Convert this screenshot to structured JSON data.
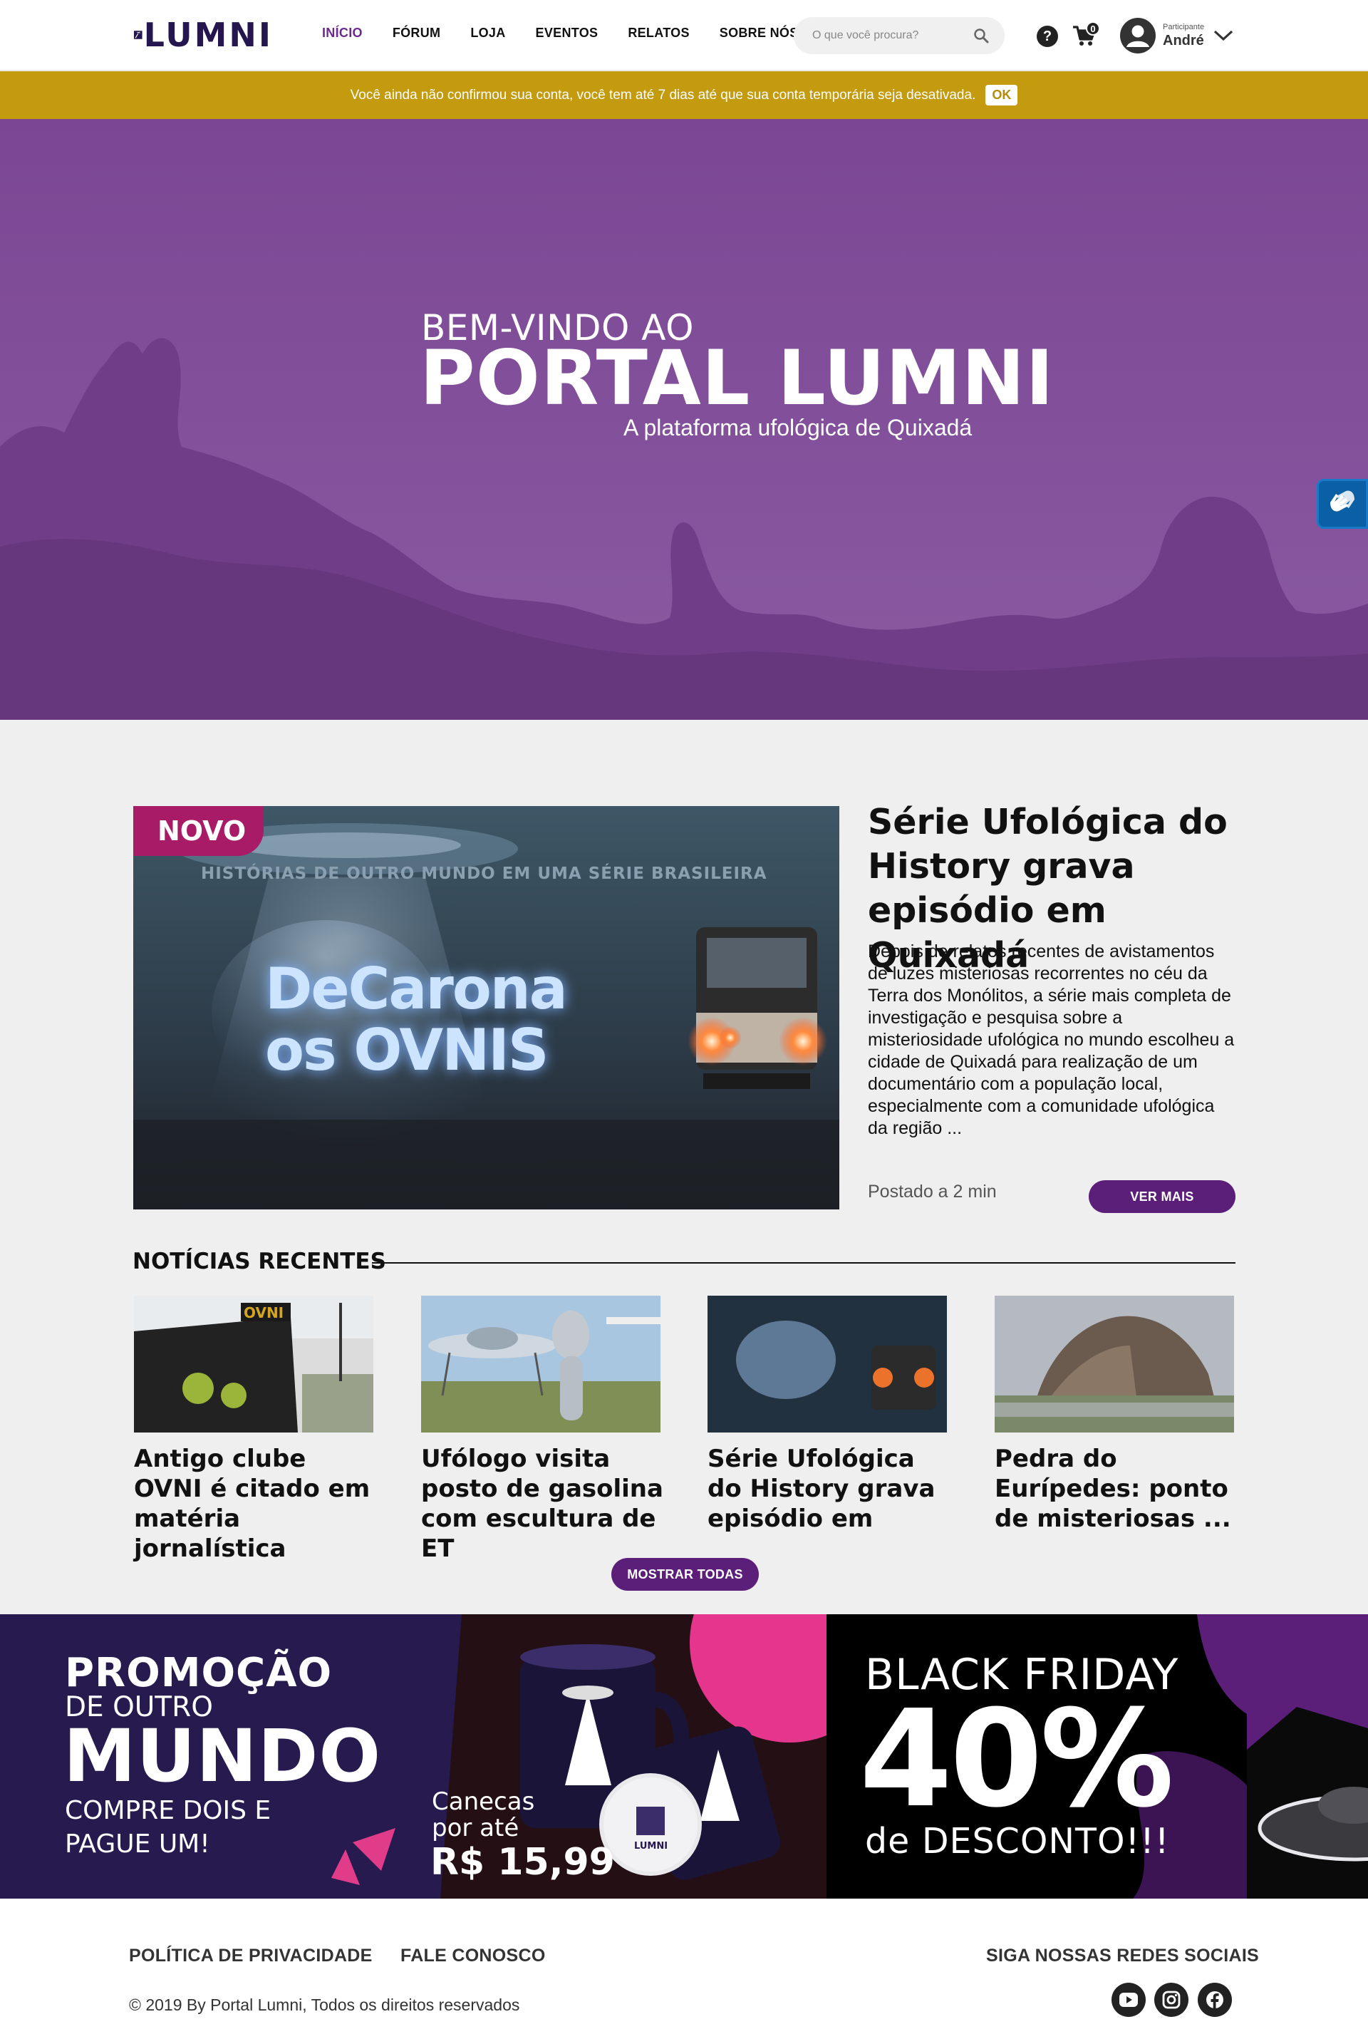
{
  "brand": {
    "name": "LUMNI"
  },
  "nav": {
    "items": [
      {
        "label": "INÍCIO",
        "active": true
      },
      {
        "label": "FÓRUM"
      },
      {
        "label": "LOJA"
      },
      {
        "label": "EVENTOS"
      },
      {
        "label": "RELATOS"
      },
      {
        "label": "SOBRE NÓS"
      }
    ]
  },
  "search": {
    "placeholder": "O que você procura?"
  },
  "header": {
    "help_glyph": "?",
    "cart_count": "0",
    "user_role": "Participante",
    "user_name": "André"
  },
  "alert": {
    "text": "Você ainda não confirmou sua conta, você tem até 7 dias até que sua conta temporária seja desativada.",
    "ok_label": "OK"
  },
  "hero": {
    "welcome": "BEM-VINDO AO",
    "title": "PORTAL LUMNI",
    "subtitle": "A plataforma ufológica de Quixadá"
  },
  "featured": {
    "badge": "NOVO",
    "image_overline": "HISTÓRIAS DE OUTRO MUNDO EM UMA SÉRIE BRASILEIRA",
    "image_title_1": "DeCarona",
    "image_title_2": "os OVNIS",
    "title": "Série Ufológica do History grava episódio em Quixadá",
    "body": "Depois de relatos recentes de avistamentos de luzes misteriosas recorrentes no céu da Terra dos Monólitos, a série mais completa de investigação e pesquisa sobre a misteriosidade ufológica no mundo escolheu a cidade de Quixadá para realização de um documentário com a população local, especialmente com a comunidade ufológica da região ...",
    "posted": "Postado a 2 min",
    "more_label": "VER MAIS"
  },
  "recent": {
    "heading": "NOTÍCIAS RECENTES",
    "cards": [
      {
        "title": "Antigo clube OVNI é citado em matéria jornalística",
        "image_sign": "OVNI"
      },
      {
        "title": "Ufólogo visita posto de gasolina com escultura de ET"
      },
      {
        "title": "Série Ufológica do History grava episódio em"
      },
      {
        "title": "Pedra do Eurípedes: ponto de misteriosas ..."
      }
    ],
    "show_all_label": "MOSTRAR TODAS"
  },
  "promo": {
    "line1": "PROMOÇÃO",
    "line2": "DE OUTRO",
    "line3": "MUNDO",
    "line4": "COMPRE DOIS E PAGUE UM!",
    "mug_text": "Canecas por até",
    "mug_price": "R$ 15,99",
    "mug_logo": "LUMNI",
    "bf_title": "BLACK FRIDAY",
    "bf_percent": "40%",
    "bf_discount": "de DESCONTO!!!"
  },
  "footer": {
    "privacy": "POLÍTICA DE PRIVACIDADE",
    "contact": "FALE CONOSCO",
    "social_heading": "SIGA NOSSAS REDES SOCIAIS",
    "copyright": "© 2019 By Portal Lumni, Todos os direitos reservados",
    "social": [
      "youtube-icon",
      "instagram-icon",
      "facebook-icon"
    ]
  },
  "colors": {
    "brand_purple": "#5c1f79",
    "hero_purple": "#7d4a96",
    "alert_gold": "#c49a0e",
    "badge_magenta": "#a81c67",
    "promo_navy": "#261a4f"
  }
}
